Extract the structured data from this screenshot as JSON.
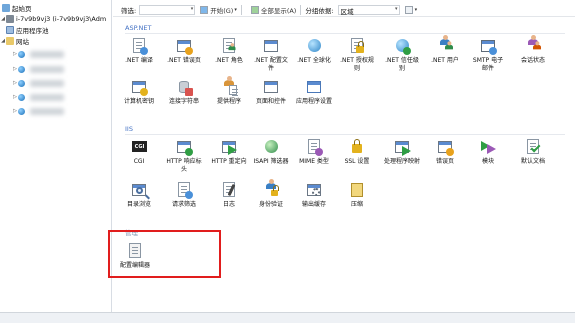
{
  "tree": {
    "items": [
      {
        "label": "起始页"
      },
      {
        "label": "i-7v9b9vj3 (i-7v9b9vj3\\Adm"
      },
      {
        "label": "应用程序池"
      },
      {
        "label": "网站"
      }
    ]
  },
  "filterbar": {
    "filter_label": "筛选:",
    "go_label": "开始(G)",
    "show_all_label": "全部显示(A)",
    "group_by_label": "分组依据:",
    "group_by_value": "区域"
  },
  "groups": [
    {
      "title": "ASP.NET",
      "tiles": [
        {
          "label": ".NET 编译",
          "icon": "compile-icon"
        },
        {
          "label": ".NET 错误页",
          "icon": "error-page-icon"
        },
        {
          "label": ".NET 角色",
          "icon": "roles-icon"
        },
        {
          "label": ".NET 配置文件",
          "icon": "profile-icon"
        },
        {
          "label": ".NET 全球化",
          "icon": "globe-icon"
        },
        {
          "label": ".NET 授权规则",
          "icon": "authorization-icon"
        },
        {
          "label": ".NET 信任级别",
          "icon": "trust-level-icon"
        },
        {
          "label": ".NET 用户",
          "icon": "users-icon"
        },
        {
          "label": "SMTP 电子邮件",
          "icon": "smtp-icon"
        },
        {
          "label": "会话状态",
          "icon": "session-state-icon"
        },
        {
          "label": "计算机密钥",
          "icon": "machine-key-icon"
        },
        {
          "label": "连接字符串",
          "icon": "connection-strings-icon"
        },
        {
          "label": "提供程序",
          "icon": "providers-icon"
        },
        {
          "label": "页面和控件",
          "icon": "pages-controls-icon"
        },
        {
          "label": "应用程序设置",
          "icon": "app-settings-icon"
        }
      ]
    },
    {
      "title": "IIS",
      "tiles": [
        {
          "label": "CGI",
          "icon": "cgi-icon"
        },
        {
          "label": "HTTP 响应标头",
          "icon": "http-headers-icon"
        },
        {
          "label": "HTTP 重定向",
          "icon": "redirect-icon"
        },
        {
          "label": "ISAPI 筛选器",
          "icon": "isapi-icon"
        },
        {
          "label": "MIME 类型",
          "icon": "mime-icon"
        },
        {
          "label": "SSL 设置",
          "icon": "ssl-lock-icon"
        },
        {
          "label": "处理程序映射",
          "icon": "handler-mappings-icon"
        },
        {
          "label": "错误页",
          "icon": "error-pages-icon"
        },
        {
          "label": "模块",
          "icon": "modules-icon"
        },
        {
          "label": "默认文档",
          "icon": "default-document-icon"
        },
        {
          "label": "目录浏览",
          "icon": "directory-browsing-icon"
        },
        {
          "label": "请求筛选",
          "icon": "request-filtering-icon"
        },
        {
          "label": "日志",
          "icon": "logging-icon"
        },
        {
          "label": "身份验证",
          "icon": "authentication-icon"
        },
        {
          "label": "输出缓存",
          "icon": "output-cache-icon"
        },
        {
          "label": "压缩",
          "icon": "compression-icon"
        }
      ]
    },
    {
      "title": "管理",
      "tiles": [
        {
          "label": "配置编辑器",
          "icon": "configuration-editor-icon"
        }
      ]
    }
  ]
}
